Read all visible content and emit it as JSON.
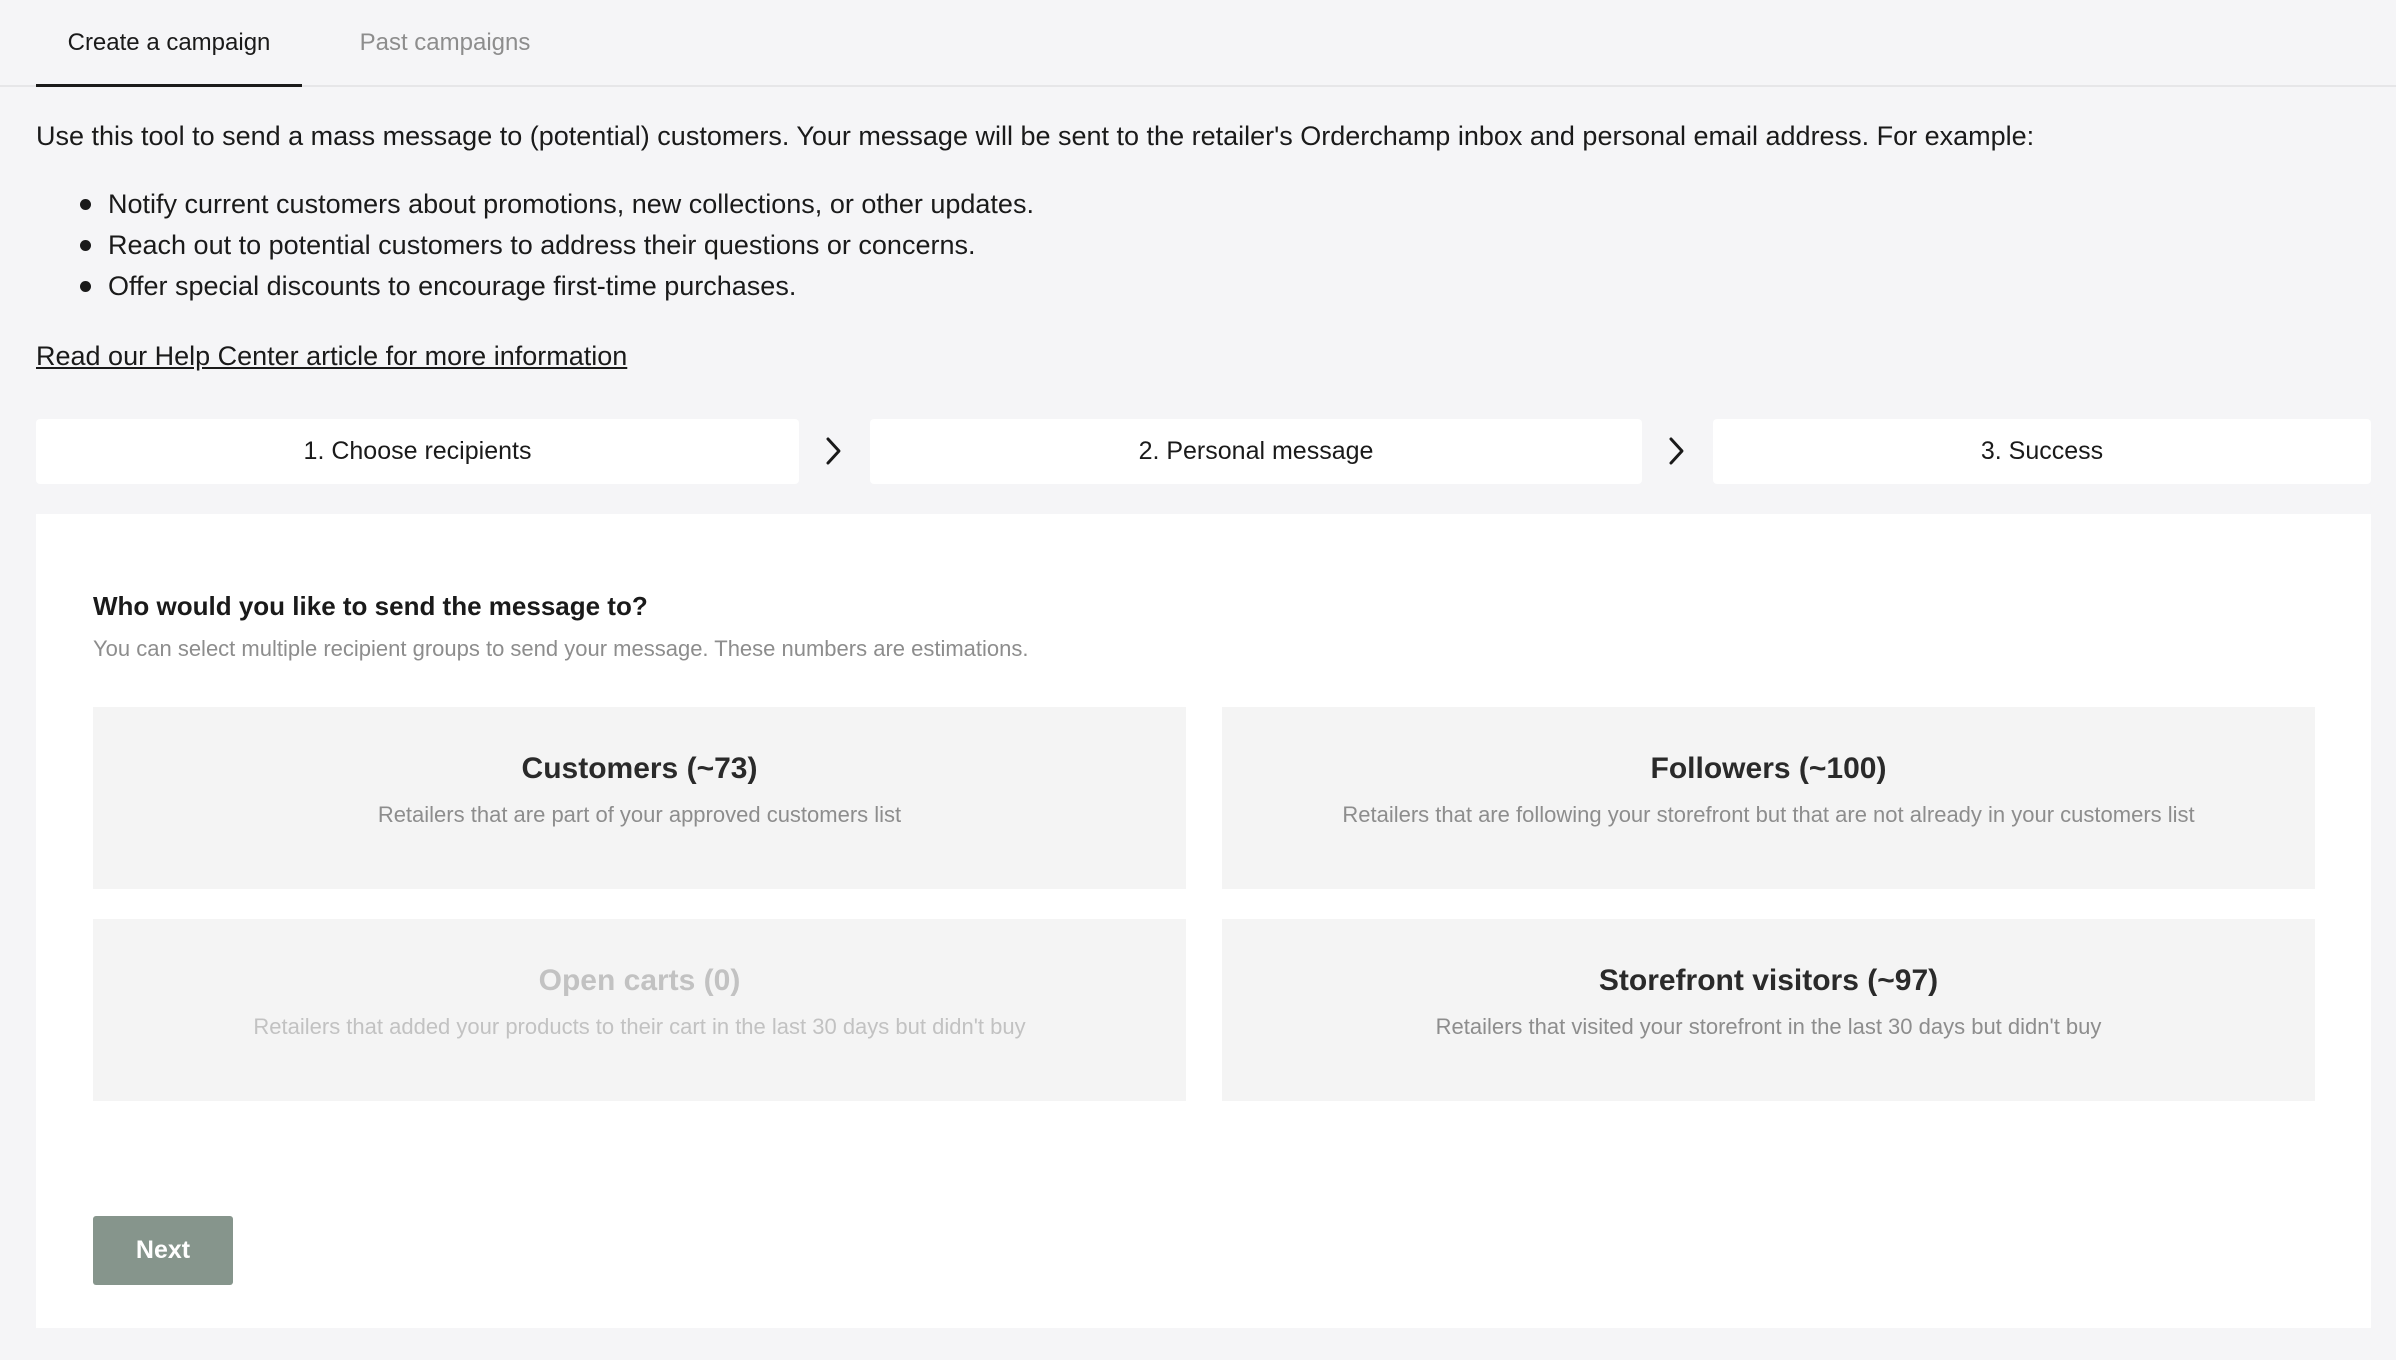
{
  "tabs": {
    "create": "Create a campaign",
    "past": "Past campaigns"
  },
  "intro": {
    "text": "Use this tool to send a mass message to (potential) customers. Your message will be sent to the retailer's Orderchamp inbox and personal email address. For example:",
    "bullets": [
      "Notify current customers about promotions, new collections, or other updates.",
      "Reach out to potential customers to address their questions or concerns.",
      "Offer special discounts to encourage first-time purchases."
    ],
    "help_link": "Read our Help Center article for more information"
  },
  "steps": [
    {
      "label": "1. Choose recipients"
    },
    {
      "label": "2. Personal message"
    },
    {
      "label": "3. Success"
    }
  ],
  "recipients": {
    "question": "Who would you like to send the message to?",
    "subtitle": "You can select multiple recipient groups to send your message. These numbers are estimations.",
    "groups": [
      {
        "title": "Customers (~73)",
        "description": "Retailers that are part of your approved customers list",
        "disabled": false
      },
      {
        "title": "Followers (~100)",
        "description": "Retailers that are following your storefront but that are not already in your customers list",
        "disabled": false
      },
      {
        "title": "Open carts (0)",
        "description": "Retailers that added your products to their cart in the last 30 days but didn't buy",
        "disabled": true
      },
      {
        "title": "Storefront visitors (~97)",
        "description": "Retailers that visited your storefront in the last 30 days but didn't buy",
        "disabled": false
      }
    ]
  },
  "actions": {
    "next": "Next"
  },
  "colors": {
    "page_background": "#f5f5f7",
    "card_background": "#f4f4f4",
    "button_background": "#86958c",
    "muted_text": "#8d8d8d",
    "disabled_text": "#c2c2c2"
  }
}
